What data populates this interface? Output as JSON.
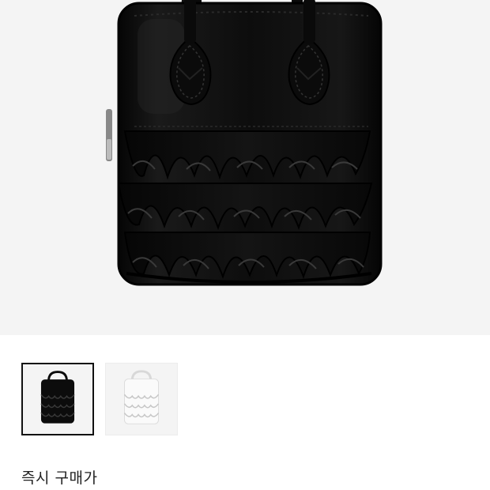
{
  "product": {
    "main_image": {
      "icon": "black-ruffle-handbag-image",
      "color": "#0c0c0c"
    },
    "thumbnails": [
      {
        "icon": "black-ruffle-handbag-thumbnail",
        "color": "#0c0c0c",
        "selected": true
      },
      {
        "icon": "white-ruffle-handbag-thumbnail",
        "color": "#f2f2f2",
        "selected": false
      }
    ]
  },
  "purchase": {
    "buy_now_label": "즉시 구매가"
  },
  "colors": {
    "hero_background": "#f4f4f4",
    "selected_border": "#111111"
  }
}
